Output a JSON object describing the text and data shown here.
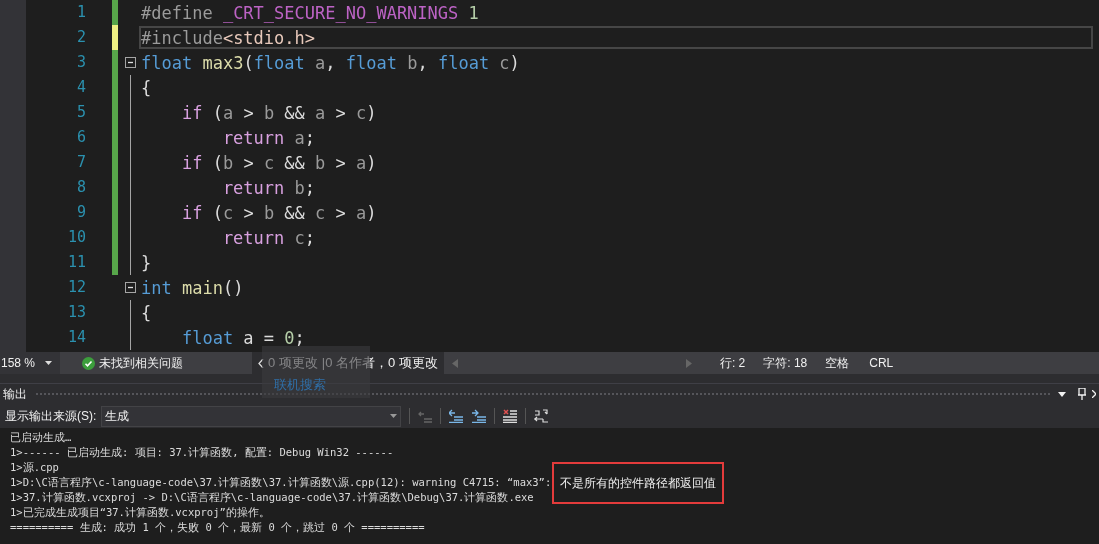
{
  "editor": {
    "lines": [
      {
        "number": "1",
        "color": "#57a64a",
        "current": false,
        "foldable": false,
        "guide": false,
        "tokens": [
          {
            "kind": "preproc",
            "text": "#define "
          },
          {
            "kind": "macro",
            "text": "_CRT_SECURE_NO_WARNINGS"
          },
          {
            "kind": "number",
            "text": " 1"
          }
        ]
      },
      {
        "number": "2",
        "color": "#eff083",
        "current": true,
        "foldable": false,
        "guide": false,
        "tokens": [
          {
            "kind": "preproc",
            "text": "#include"
          },
          {
            "kind": "string",
            "text": "<stdio.h>"
          }
        ]
      },
      {
        "number": "3",
        "color": "#57a64a",
        "current": false,
        "foldable": true,
        "guide": false,
        "tokens": [
          {
            "kind": "keyword",
            "text": "float "
          },
          {
            "kind": "function",
            "text": "max3"
          },
          {
            "kind": "plain",
            "text": "("
          },
          {
            "kind": "keyword",
            "text": "float"
          },
          {
            "kind": "param",
            "text": " a"
          },
          {
            "kind": "plain",
            "text": ", "
          },
          {
            "kind": "keyword",
            "text": "float"
          },
          {
            "kind": "param",
            "text": " b"
          },
          {
            "kind": "plain",
            "text": ", "
          },
          {
            "kind": "keyword",
            "text": "float"
          },
          {
            "kind": "param",
            "text": " c"
          },
          {
            "kind": "plain",
            "text": ")"
          }
        ]
      },
      {
        "number": "4",
        "color": "#57a64a",
        "current": false,
        "foldable": false,
        "guide": true,
        "tokens": [
          {
            "kind": "plain",
            "text": "{"
          }
        ]
      },
      {
        "number": "5",
        "color": "#57a64a",
        "current": false,
        "foldable": false,
        "guide": true,
        "tokens": [
          {
            "kind": "control",
            "text": "    if"
          },
          {
            "kind": "plain",
            "text": " ("
          },
          {
            "kind": "param",
            "text": "a"
          },
          {
            "kind": "plain",
            "text": " > "
          },
          {
            "kind": "param",
            "text": "b"
          },
          {
            "kind": "plain",
            "text": " && "
          },
          {
            "kind": "param",
            "text": "a"
          },
          {
            "kind": "plain",
            "text": " > "
          },
          {
            "kind": "param",
            "text": "c"
          },
          {
            "kind": "plain",
            "text": ")"
          }
        ]
      },
      {
        "number": "6",
        "color": "#57a64a",
        "current": false,
        "foldable": false,
        "guide": true,
        "tokens": [
          {
            "kind": "control",
            "text": "        return"
          },
          {
            "kind": "param",
            "text": " a"
          },
          {
            "kind": "plain",
            "text": ";"
          }
        ]
      },
      {
        "number": "7",
        "color": "#57a64a",
        "current": false,
        "foldable": false,
        "guide": true,
        "tokens": [
          {
            "kind": "control",
            "text": "    if"
          },
          {
            "kind": "plain",
            "text": " ("
          },
          {
            "kind": "param",
            "text": "b"
          },
          {
            "kind": "plain",
            "text": " > "
          },
          {
            "kind": "param",
            "text": "c"
          },
          {
            "kind": "plain",
            "text": " && "
          },
          {
            "kind": "param",
            "text": "b"
          },
          {
            "kind": "plain",
            "text": " > "
          },
          {
            "kind": "param",
            "text": "a"
          },
          {
            "kind": "plain",
            "text": ")"
          }
        ]
      },
      {
        "number": "8",
        "color": "#57a64a",
        "current": false,
        "foldable": false,
        "guide": true,
        "tokens": [
          {
            "kind": "control",
            "text": "        return"
          },
          {
            "kind": "param",
            "text": " b"
          },
          {
            "kind": "plain",
            "text": ";"
          }
        ]
      },
      {
        "number": "9",
        "color": "#57a64a",
        "current": false,
        "foldable": false,
        "guide": true,
        "tokens": [
          {
            "kind": "control",
            "text": "    if"
          },
          {
            "kind": "plain",
            "text": " ("
          },
          {
            "kind": "param",
            "text": "c"
          },
          {
            "kind": "plain",
            "text": " > "
          },
          {
            "kind": "param",
            "text": "b"
          },
          {
            "kind": "plain",
            "text": " && "
          },
          {
            "kind": "param",
            "text": "c"
          },
          {
            "kind": "plain",
            "text": " > "
          },
          {
            "kind": "param",
            "text": "a"
          },
          {
            "kind": "plain",
            "text": ")"
          }
        ]
      },
      {
        "number": "10",
        "color": "#57a64a",
        "current": false,
        "foldable": false,
        "guide": true,
        "tokens": [
          {
            "kind": "control",
            "text": "        return"
          },
          {
            "kind": "param",
            "text": " c"
          },
          {
            "kind": "plain",
            "text": ";"
          }
        ]
      },
      {
        "number": "11",
        "color": "#57a64a",
        "current": false,
        "foldable": false,
        "guide": true,
        "tokens": [
          {
            "kind": "plain",
            "text": "}"
          }
        ]
      },
      {
        "number": "12",
        "current": false,
        "foldable": true,
        "guide": false,
        "tokens": [
          {
            "kind": "keyword",
            "text": "int "
          },
          {
            "kind": "function",
            "text": "main"
          },
          {
            "kind": "plain",
            "text": "()"
          }
        ]
      },
      {
        "number": "13",
        "current": false,
        "foldable": false,
        "guide": true,
        "tokens": [
          {
            "kind": "plain",
            "text": "{"
          }
        ]
      },
      {
        "number": "14",
        "current": false,
        "foldable": false,
        "guide": true,
        "tokens": [
          {
            "kind": "keyword",
            "text": "    float"
          },
          {
            "kind": "plain",
            "text": " a = "
          },
          {
            "kind": "number",
            "text": "0"
          },
          {
            "kind": "plain",
            "text": ";"
          }
        ]
      }
    ]
  },
  "status_bar": {
    "zoom": "158 %",
    "issues": "未找到相关问题",
    "changes": "0 项更改",
    "authors": "|0 名作者，0 项更改",
    "line": "行: 2",
    "char": "字符: 18",
    "indent": "空格",
    "line_ending": "CRL"
  },
  "tooltip": {
    "text": "联机搜索"
  },
  "output": {
    "title": "输出",
    "source_label": "显示输出来源(S):",
    "source": "生成",
    "lines": [
      {
        "text": "已启动生成…"
      },
      {
        "text": "1>------ 已启动生成: 项目: 37.计算函数, 配置: Debug Win32 ------"
      },
      {
        "text": "1>源.cpp"
      },
      {
        "text": "1>D:\\C语言程序\\c-language-code\\37.计算函数\\37.计算函数\\源.cpp(12): warning C4715: “max3”: ",
        "annotated": "不是所有的控件路径都返回值"
      },
      {
        "text": "1>37.计算函数.vcxproj -> D:\\C语言程序\\c-language-code\\37.计算函数\\Debug\\37.计算函数.exe"
      },
      {
        "text": "1>已完成生成项目“37.计算函数.vcxproj”的操作。"
      },
      {
        "text": "========== 生成: 成功 1 个，失败 0 个，最新 0 个，跳过 0 个 =========="
      }
    ]
  }
}
